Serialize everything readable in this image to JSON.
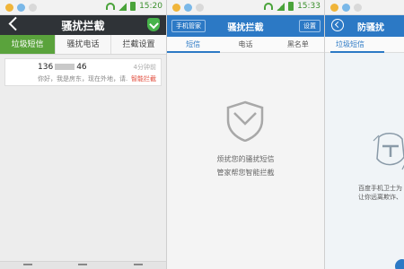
{
  "panel1": {
    "status_time": "15:20",
    "title": "骚扰拦截",
    "tabs": [
      "垃圾短信",
      "骚扰电话",
      "拦截设置"
    ],
    "message": {
      "number_prefix": "136",
      "number_suffix": "46",
      "time": "4分钟前",
      "body": "你好，我是房东，现在外地，请...",
      "tag": "智能拦截"
    }
  },
  "panel2": {
    "status_time": "15:33",
    "left_button": "手机管家",
    "title": "骚扰拦截",
    "right_button": "设置",
    "tabs": [
      "短信",
      "电话",
      "黑名单"
    ],
    "empty_line1": "烦扰您的骚扰短信",
    "empty_line2": "管家帮您智能拦截"
  },
  "panel3": {
    "title": "防骚扰",
    "tab": "垃圾短信",
    "line1": "百度手机卫士为",
    "line2": "让你远离欺诈、"
  },
  "colors": {
    "green": "#5aa33c",
    "blue": "#2c79c5",
    "dark": "#2f3337",
    "red": "#e14b3b"
  }
}
